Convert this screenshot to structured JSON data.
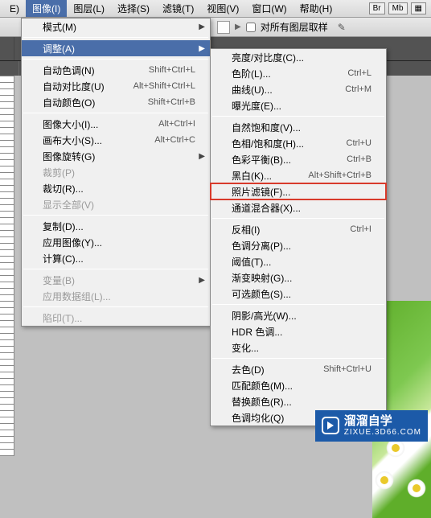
{
  "menubar": {
    "items": [
      {
        "label": "E)"
      },
      {
        "label": "图像(I)",
        "active": true
      },
      {
        "label": "图层(L)"
      },
      {
        "label": "选择(S)"
      },
      {
        "label": "滤镜(T)"
      },
      {
        "label": "视图(V)"
      },
      {
        "label": "窗口(W)"
      },
      {
        "label": "帮助(H)"
      }
    ],
    "extras": [
      "Br",
      "Mb"
    ]
  },
  "toolbar": {
    "checkbox_label": "对所有图层取样"
  },
  "image_menu": {
    "items": [
      {
        "label": "模式(M)",
        "arrow": true
      },
      {
        "sep": true
      },
      {
        "label": "调整(A)",
        "arrow": true,
        "highlight": true
      },
      {
        "sep": true
      },
      {
        "label": "自动色调(N)",
        "shortcut": "Shift+Ctrl+L"
      },
      {
        "label": "自动对比度(U)",
        "shortcut": "Alt+Shift+Ctrl+L"
      },
      {
        "label": "自动颜色(O)",
        "shortcut": "Shift+Ctrl+B"
      },
      {
        "sep": true
      },
      {
        "label": "图像大小(I)...",
        "shortcut": "Alt+Ctrl+I"
      },
      {
        "label": "画布大小(S)...",
        "shortcut": "Alt+Ctrl+C"
      },
      {
        "label": "图像旋转(G)",
        "arrow": true
      },
      {
        "label": "裁剪(P)",
        "disabled": true
      },
      {
        "label": "裁切(R)..."
      },
      {
        "label": "显示全部(V)",
        "disabled": true
      },
      {
        "sep": true
      },
      {
        "label": "复制(D)..."
      },
      {
        "label": "应用图像(Y)..."
      },
      {
        "label": "计算(C)..."
      },
      {
        "sep": true
      },
      {
        "label": "变量(B)",
        "arrow": true,
        "disabled": true
      },
      {
        "label": "应用数据组(L)...",
        "disabled": true
      },
      {
        "sep": true
      },
      {
        "label": "陷印(T)...",
        "disabled": true
      }
    ]
  },
  "adjust_submenu": {
    "items": [
      {
        "label": "亮度/对比度(C)..."
      },
      {
        "label": "色阶(L)...",
        "shortcut": "Ctrl+L"
      },
      {
        "label": "曲线(U)...",
        "shortcut": "Ctrl+M"
      },
      {
        "label": "曝光度(E)..."
      },
      {
        "sep": true
      },
      {
        "label": "自然饱和度(V)..."
      },
      {
        "label": "色相/饱和度(H)...",
        "shortcut": "Ctrl+U"
      },
      {
        "label": "色彩平衡(B)...",
        "shortcut": "Ctrl+B"
      },
      {
        "label": "黑白(K)...",
        "shortcut": "Alt+Shift+Ctrl+B"
      },
      {
        "label": "照片滤镜(F)...",
        "redbox": true
      },
      {
        "label": "通道混合器(X)..."
      },
      {
        "sep": true
      },
      {
        "label": "反相(I)",
        "shortcut": "Ctrl+I"
      },
      {
        "label": "色调分离(P)..."
      },
      {
        "label": "阈值(T)..."
      },
      {
        "label": "渐变映射(G)..."
      },
      {
        "label": "可选颜色(S)..."
      },
      {
        "sep": true
      },
      {
        "label": "阴影/高光(W)..."
      },
      {
        "label": "HDR 色调..."
      },
      {
        "label": "变化..."
      },
      {
        "sep": true
      },
      {
        "label": "去色(D)",
        "shortcut": "Shift+Ctrl+U"
      },
      {
        "label": "匹配颜色(M)..."
      },
      {
        "label": "替换颜色(R)..."
      },
      {
        "label": "色调均化(Q)"
      }
    ]
  },
  "watermark": {
    "title": "溜溜自学",
    "subtitle": "ZIXUE.3D66.COM"
  }
}
